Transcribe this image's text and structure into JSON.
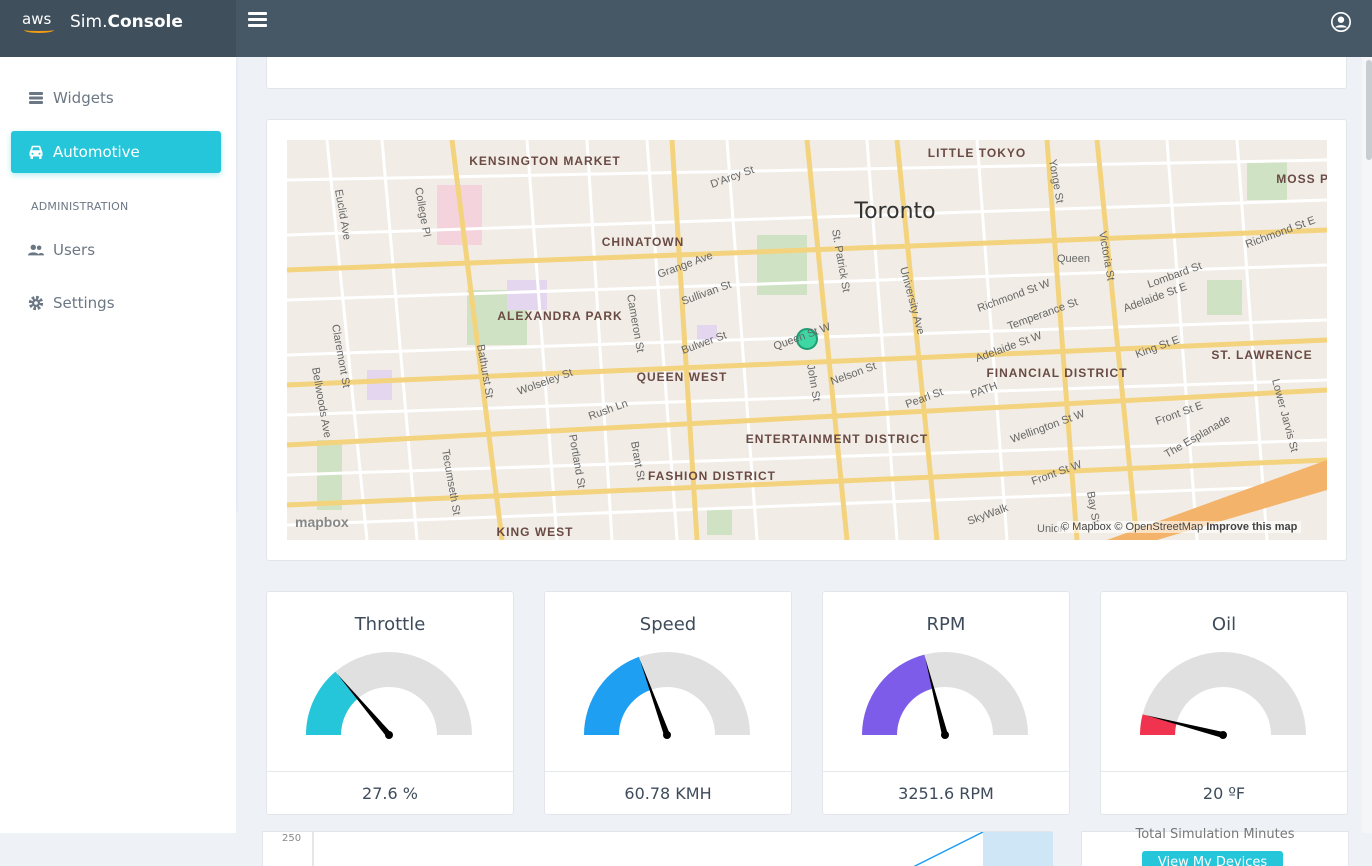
{
  "header": {
    "aws_logo": "aws",
    "app_prefix": "Sim.",
    "app_name": "Console",
    "colors": {
      "bar": "#465865",
      "brand": "#3f505c"
    }
  },
  "sidebar": {
    "items": [
      {
        "label": "Widgets",
        "icon": "layers-icon"
      },
      {
        "label": "Automotive",
        "icon": "car-icon",
        "active": true
      }
    ],
    "section_label": "ADMINISTRATION",
    "admin_items": [
      {
        "label": "Users",
        "icon": "users-icon"
      },
      {
        "label": "Settings",
        "icon": "gear-icon"
      }
    ],
    "accent": "#26c6da"
  },
  "map": {
    "city": "Toronto",
    "labels": [
      "KENSINGTON MARKET",
      "LITTLE TOKYO",
      "MOSS PA",
      "CHINATOWN",
      "ALEXANDRA PARK",
      "QUEEN WEST",
      "ENTERTAINMENT DISTRICT",
      "FINANCIAL DISTRICT",
      "ST. LAWRENCE",
      "FASHION DISTRICT",
      "KING WEST"
    ],
    "streets": [
      "Euclid Ave",
      "College Pl",
      "D'Arcy St",
      "Grange Ave",
      "Sullivan St",
      "Cameron St",
      "Bulwer St",
      "Queen St W",
      "Wolseley St",
      "Rush Ln",
      "Portland St",
      "Brant St",
      "Bathurst St",
      "Claremont St",
      "Bellwoods Ave",
      "Tecumseth St",
      "St. Patrick St",
      "University Ave",
      "John St",
      "Nelson St",
      "Pearl St",
      "Richmond St W",
      "Temperance St",
      "Adelaide St W",
      "Wellington St W",
      "Front St W",
      "King St E",
      "Adelaide St E",
      "Lombard St",
      "Richmond St E",
      "Front St E",
      "The Esplanade",
      "Lower Jarvis St",
      "Yonge St",
      "Victoria St",
      "Bay St",
      "PATH",
      "SkyWalk",
      "Queen",
      "Union"
    ],
    "mapbox_label": "mapbox",
    "attribution": "© Mapbox © OpenStreetMap",
    "improve_link": "Improve this map",
    "marker_color": "#3ed6a2"
  },
  "gauges": [
    {
      "title": "Throttle",
      "readout": "27.6 %",
      "fraction": 0.276,
      "color": "#26c6da"
    },
    {
      "title": "Speed",
      "readout": "60.78 KMH",
      "fraction": 0.39,
      "color": "#1e9ff2"
    },
    {
      "title": "RPM",
      "readout": "3251.6 RPM",
      "fraction": 0.42,
      "color": "#7c5ce9"
    },
    {
      "title": "Oil",
      "readout": "20 ºF",
      "fraction": 0.08,
      "color": "#f0344f"
    }
  ],
  "bottom": {
    "chart_tick": "250",
    "stats_title": "Total Simulation Minutes",
    "view_button": "View My Devices"
  }
}
